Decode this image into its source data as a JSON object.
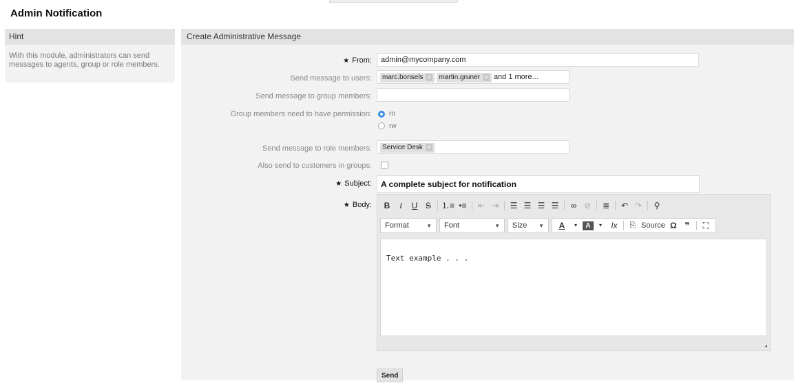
{
  "page": {
    "title": "Admin Notification"
  },
  "sidebar": {
    "header": "Hint",
    "text": "With this module, administrators can send messages to agents, group or role members."
  },
  "form": {
    "header": "Create Administrative Message",
    "from": {
      "label": "From:",
      "value": "admin@mycompany.com"
    },
    "users": {
      "label": "Send message to users:",
      "tags": [
        "marc.bonsels",
        "martin.gruner"
      ],
      "more": "and 1 more..."
    },
    "groups": {
      "label": "Send message to group members:",
      "value": ""
    },
    "permission": {
      "label": "Group members need to have permission:",
      "options": [
        "ro",
        "rw"
      ],
      "selected": "ro"
    },
    "roles": {
      "label": "Send message to role members:",
      "tags": [
        "Service Desk"
      ]
    },
    "customers": {
      "label": "Also send to customers in groups:",
      "checked": false
    },
    "subject": {
      "label": "Subject:",
      "value": "A complete subject for notification"
    },
    "body": {
      "label": "Body:",
      "toolbar": {
        "format": "Format",
        "font": "Font",
        "size": "Size",
        "source": "Source"
      },
      "text": "Text example . . ."
    },
    "send_label": "Send"
  }
}
